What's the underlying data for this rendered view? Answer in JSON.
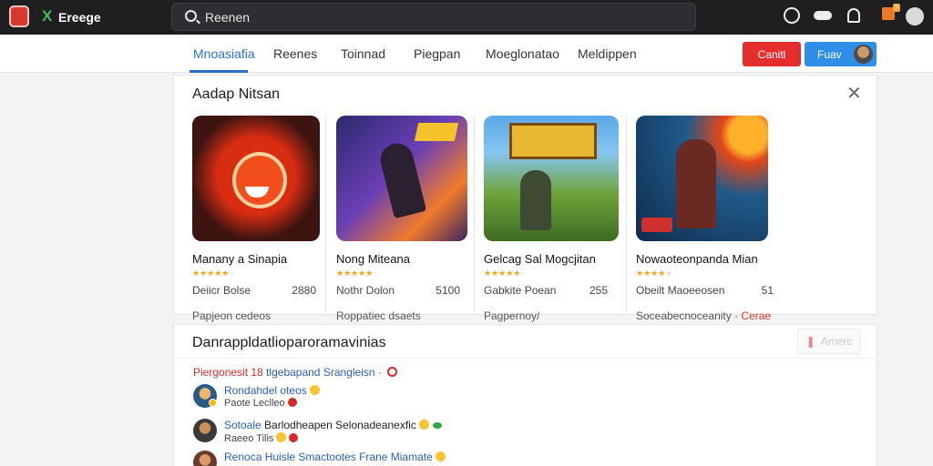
{
  "topbar": {
    "brand": "Ereege",
    "search_value": "Reenen",
    "notif_badge": "?"
  },
  "nav": {
    "items": [
      "Mnoasiafia",
      "Reenes",
      "Toinnad",
      "Piegpan",
      "Moeglonatao",
      "Meldippen"
    ],
    "active_index": 0,
    "red_button": "Canitl",
    "blue_button": "Fuav"
  },
  "panel": {
    "title": "Aadap Nitsan",
    "cards": [
      {
        "title": "Manany a Sinapia",
        "rating_stars": 5,
        "meta": "Deiicr Bolse",
        "number": "2880",
        "footer": "Papjeon cedeos",
        "tag": ""
      },
      {
        "title": "Nong Miteana",
        "rating_stars": 5,
        "meta": "Nothr Dolon",
        "number": "5100",
        "footer": "Roppatiec dsaets",
        "tag": ""
      },
      {
        "title": "Gelcag Sal Mogcjitan",
        "rating_stars": 5,
        "meta": "Gabkite Poean",
        "number": "255",
        "footer": "Pagpernoy/",
        "tag": ""
      },
      {
        "title": "Nowaoteonpanda Mian",
        "rating_stars": 4,
        "meta": "Obeilt Maoeeosen",
        "number": "51",
        "footer": "Soceabecnoceanity ·",
        "tag": "Cerae"
      }
    ]
  },
  "panel2": {
    "title": "Danrappldatlioparoramavinias",
    "follow_label": "Amerc",
    "headline_red": "Piergonesit",
    "headline_num": "18",
    "headline_blue": "tlgebapand Srangleisn",
    "headline_tail": "·",
    "comments": [
      {
        "name": "Rondahdel",
        "text": "oteos",
        "meta": "Paote Leclleo"
      },
      {
        "name": "Sotoale",
        "text": "Barlodheapen Selonadeanexfic",
        "meta": "Raeeo Tilis"
      },
      {
        "name": "Renoca Huisle",
        "text": "Smactootes Frane Miamate",
        "meta": ""
      }
    ]
  },
  "colors": {
    "accent_blue": "#2a72c8",
    "danger_red": "#e52d2d",
    "primary_blue": "#2f8fe8",
    "star": "#f0a81a",
    "topbar_bg": "#1f1f22"
  }
}
